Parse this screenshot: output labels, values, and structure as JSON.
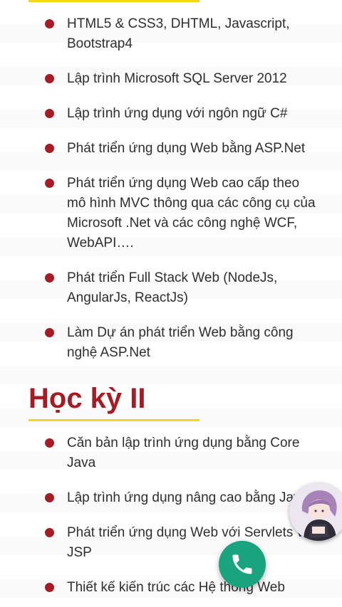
{
  "semester1": {
    "items": [
      "HTML5 & CSS3, DHTML, Javascript, Bootstrap4",
      "Lập trình Microsoft SQL Server 2012",
      "Lập trình ứng dụng với ngôn ngữ C#",
      "Phát triển ứng dụng Web bằng ASP.Net",
      "Phát triển ứng dụng Web cao cấp theo mô hình MVC thông qua các công cụ của Microsoft .Net và các công nghệ WCF, WebAPI….",
      "Phát triển Full Stack Web (NodeJs, AngularJs, ReactJs)",
      "Làm Dự án phát triển Web bằng công nghệ ASP.Net"
    ]
  },
  "semester2": {
    "title": "Học kỳ II",
    "items": [
      "Căn bản lập trình ứng dụng bằng Core Java",
      "Lập trình ứng dụng nâng cao bằng Java",
      "Phát triển ứng dụng Web với Servlets và JSP",
      "Thiết kế kiến trúc các Hệ thống Web"
    ]
  },
  "colors": {
    "heading": "#a51c25",
    "bullet": "#a51c25",
    "underline": "#f1d815",
    "call_button": "#1aa37f"
  },
  "icons": {
    "call": "phone-icon",
    "avatar": "anime-avatar"
  }
}
